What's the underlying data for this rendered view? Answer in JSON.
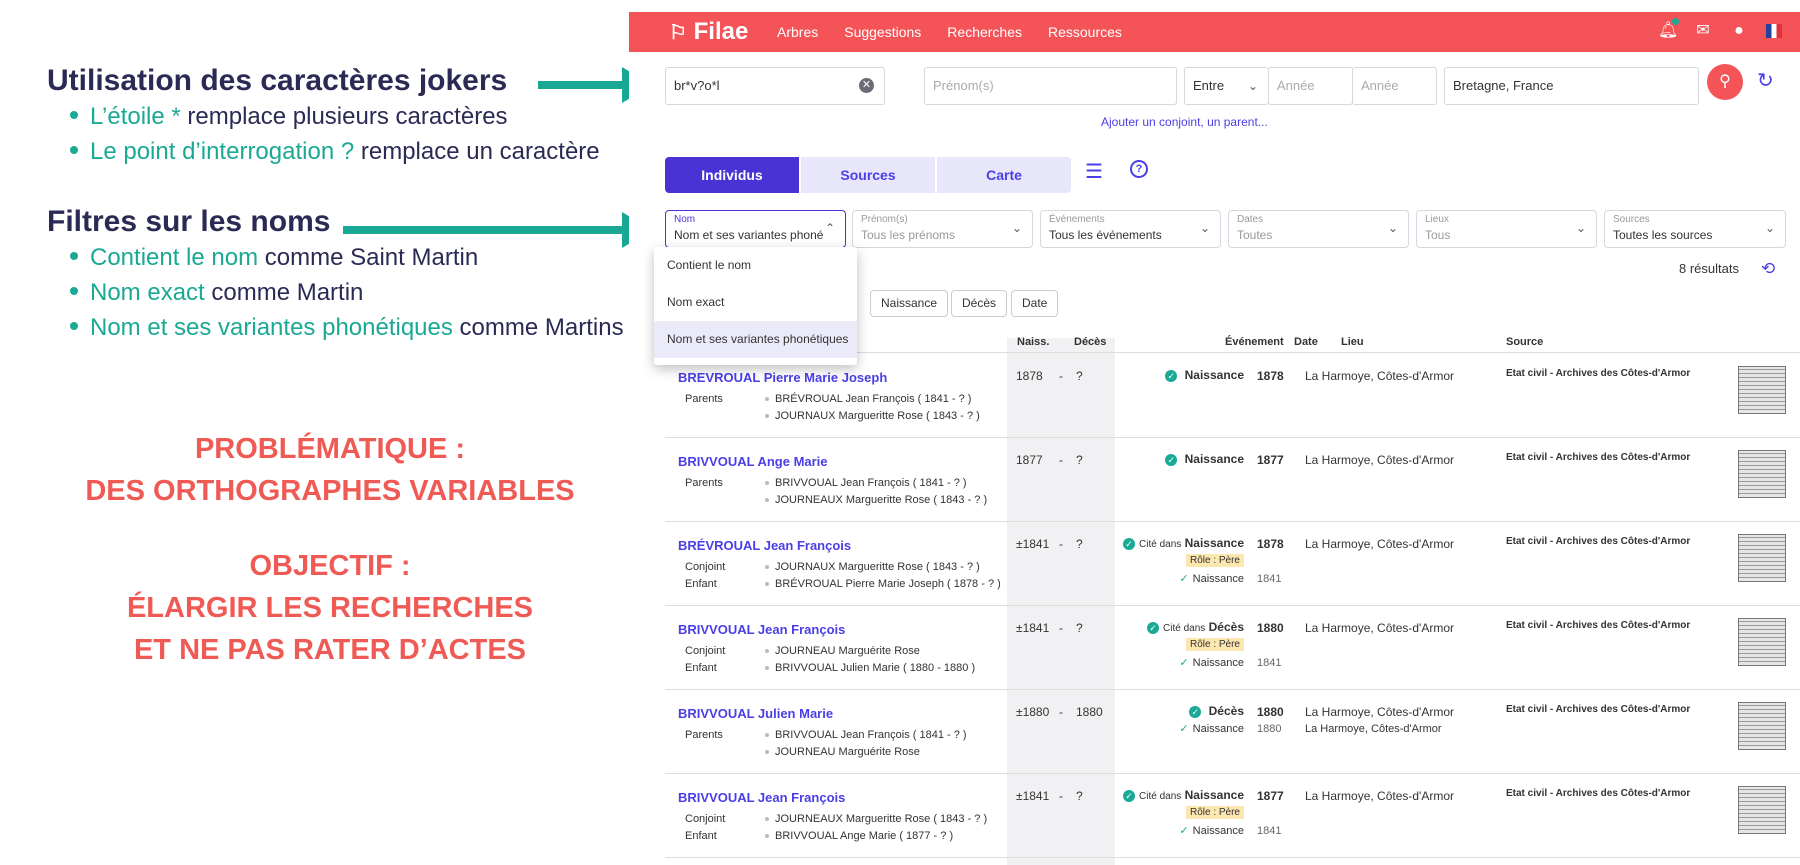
{
  "slide": {
    "heading1": "Utilisation des caractères jokers",
    "bullets1": [
      {
        "term": "L’étoile * ",
        "rest": " remplace plusieurs caractères"
      },
      {
        "term": "Le point d’interrogation ?",
        "rest": " remplace un caractère"
      }
    ],
    "heading2": "Filtres sur les noms",
    "bullets2": [
      {
        "term": "Contient le nom",
        "rest": " comme Saint Martin"
      },
      {
        "term": "Nom exact",
        "rest": " comme Martin"
      },
      {
        "term": "Nom et ses variantes phonétiques",
        "rest": " comme Martins"
      }
    ],
    "problem_l1": "PROBLÉMATIQUE :",
    "problem_l2": "DES ORTHOGRAPHES VARIABLES",
    "goal_l1": "OBJECTIF :",
    "goal_l2": "ÉLARGIR LES RECHERCHES",
    "goal_l3": "ET NE PAS RATER D’ACTES"
  },
  "nav": {
    "logo": "Filae",
    "items": [
      "Arbres",
      "Suggestions",
      "Recherches",
      "Ressources"
    ]
  },
  "search": {
    "name_value": "br*v?o*l",
    "firstname_placeholder": "Prénom(s)",
    "between": "Entre",
    "year1_placeholder": "Année",
    "year2_placeholder": "Année",
    "place_value": "Bretagne, France",
    "add_link": "Ajouter un conjoint, un parent..."
  },
  "tabs": [
    "Individus",
    "Sources",
    "Carte"
  ],
  "filters": [
    {
      "label": "Nom",
      "value": "Nom et ses variantes phoné..."
    },
    {
      "label": "Prénom(s)",
      "value": "Tous les prénoms"
    },
    {
      "label": "Événements",
      "value": "Tous les événements"
    },
    {
      "label": "Dates",
      "value": "Toutes"
    },
    {
      "label": "Lieux",
      "value": "Tous"
    },
    {
      "label": "Sources",
      "value": "Toutes les sources"
    }
  ],
  "dropdown": [
    "Contient le nom",
    "Nom exact",
    "Nom et ses variantes phonétiques"
  ],
  "results_count": "8 résultats",
  "sort_pills": [
    "Naissance",
    "Décès",
    "Date"
  ],
  "columns": {
    "birth": "Naiss.",
    "death": "Décès",
    "event": "Événement",
    "date": "Date",
    "place": "Lieu",
    "source": "Source"
  },
  "rows": [
    {
      "name": "BREVROUAL Pierre Marie Joseph",
      "rel1": "Parents",
      "v1": "BRÉVROUAL Jean François ( 1841 - ? )",
      "rel2": "",
      "v2": "JOURNAUX Margueritte Rose ( 1843 - ? )",
      "birth": "1878",
      "dash": "-",
      "death": "?",
      "cited": "",
      "event": "Naissance",
      "role": "",
      "sub_event": "",
      "sub_date": "",
      "sub_place": "",
      "date": "1878",
      "place": "La Harmoye, Côtes-d'Armor",
      "source": "Etat civil - Archives des Côtes-d'Armor"
    },
    {
      "name": "BRIVVOUAL Ange Marie",
      "rel1": "Parents",
      "v1": "BRIVVOUAL Jean François ( 1841 - ? )",
      "rel2": "",
      "v2": "JOURNEAUX Margueritte Rose ( 1843 - ? )",
      "birth": "1877",
      "dash": "-",
      "death": "?",
      "cited": "",
      "event": "Naissance",
      "role": "",
      "sub_event": "",
      "sub_date": "",
      "sub_place": "",
      "date": "1877",
      "place": "La Harmoye, Côtes-d'Armor",
      "source": "Etat civil - Archives des Côtes-d'Armor"
    },
    {
      "name": "BRÉVROUAL Jean François",
      "rel1": "Conjoint",
      "v1": "JOURNAUX Margueritte Rose ( 1843 - ? )",
      "rel2": "Enfant",
      "v2": "BRÉVROUAL Pierre Marie Joseph ( 1878 - ? )",
      "birth": "±1841",
      "dash": "-",
      "death": "?",
      "cited": "Cité dans",
      "event": "Naissance",
      "role": "Rôle : Père",
      "sub_event": "Naissance",
      "sub_date": "1841",
      "sub_place": "",
      "date": "1878",
      "place": "La Harmoye, Côtes-d'Armor",
      "source": "Etat civil - Archives des Côtes-d'Armor"
    },
    {
      "name": "BRIVVOUAL Jean François",
      "rel1": "Conjoint",
      "v1": "JOURNEAU Marguérite Rose",
      "rel2": "Enfant",
      "v2": "BRIVVOUAL Julien Marie ( 1880 - 1880 )",
      "birth": "±1841",
      "dash": "-",
      "death": "?",
      "cited": "Cité dans",
      "event": "Décès",
      "role": "Rôle : Père",
      "sub_event": "Naissance",
      "sub_date": "1841",
      "sub_place": "",
      "date": "1880",
      "place": "La Harmoye, Côtes-d'Armor",
      "source": "Etat civil - Archives des Côtes-d'Armor"
    },
    {
      "name": "BRIVVOUAL Julien Marie",
      "rel1": "Parents",
      "v1": "BRIVVOUAL Jean François ( 1841 - ? )",
      "rel2": "",
      "v2": "JOURNEAU Marguérite Rose",
      "birth": "±1880",
      "dash": "-",
      "death": "1880",
      "cited": "",
      "event": "Décès",
      "role": "",
      "sub_event": "Naissance",
      "sub_date": "1880",
      "sub_place": "La Harmoye, Côtes-d'Armor",
      "date": "1880",
      "place": "La Harmoye, Côtes-d'Armor",
      "source": "Etat civil - Archives des Côtes-d'Armor"
    },
    {
      "name": "BRIVVOUAL Jean François",
      "rel1": "Conjoint",
      "v1": "JOURNEAUX Margueritte Rose ( 1843 - ? )",
      "rel2": "Enfant",
      "v2": "BRIVVOUAL Ange Marie ( 1877 - ? )",
      "birth": "±1841",
      "dash": "-",
      "death": "?",
      "cited": "Cité dans",
      "event": "Naissance",
      "role": "Rôle : Père",
      "sub_event": "Naissance",
      "sub_date": "1841",
      "sub_place": "",
      "date": "1877",
      "place": "La Harmoye, Côtes-d'Armor",
      "source": "Etat civil - Archives des Côtes-d'Armor"
    }
  ]
}
